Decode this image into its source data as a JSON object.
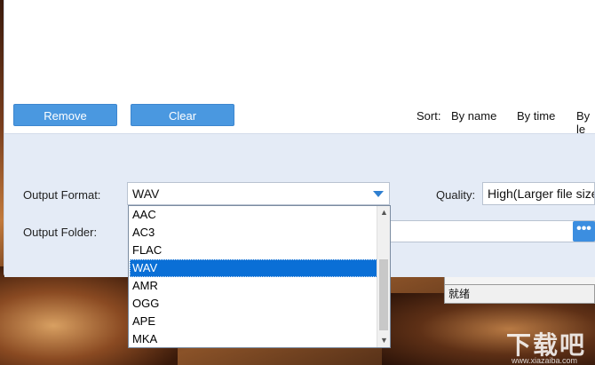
{
  "toolbar": {
    "remove_label": "Remove",
    "clear_label": "Clear",
    "sort_label": "Sort:",
    "sort_by_name": "By name",
    "sort_by_time": "By time",
    "sort_by_l": "By le"
  },
  "settings": {
    "output_format_label": "Output Format:",
    "output_format_value": "WAV",
    "quality_label": "Quality:",
    "quality_value": "High(Larger file size)",
    "output_folder_label": "Output Folder:",
    "browse_button": "•••"
  },
  "dropdown": {
    "items": [
      "AAC",
      "AC3",
      "FLAC",
      "WAV",
      "AMR",
      "OGG",
      "APE",
      "MKA"
    ],
    "selected": "WAV"
  },
  "status": {
    "text": "就绪"
  },
  "watermark": {
    "text": "下载吧",
    "url": "www.xiazaiba.com"
  },
  "colors": {
    "accent": "#4a98e0",
    "panel": "#e4ebf6",
    "selection": "#0a6fd6"
  }
}
